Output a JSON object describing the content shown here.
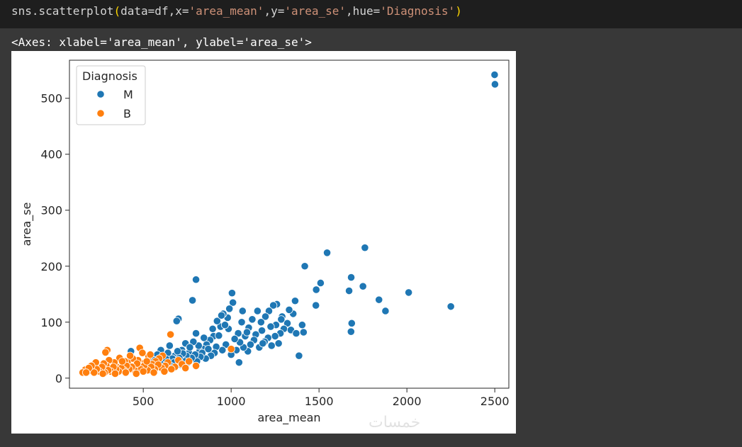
{
  "cell": {
    "code_prefix": "sns.scatterplot",
    "code_paren_open": "(",
    "code_arg1": "data=df,x=",
    "code_str1": "'area_mean'",
    "code_arg2": ",y=",
    "code_str2": "'area_se'",
    "code_arg3": ",hue=",
    "code_str3": "'Diagnosis'",
    "code_paren_close": ")"
  },
  "output": {
    "repr": "<Axes: xlabel='area_mean', ylabel='area_se'>"
  },
  "watermark": "خمسات",
  "colors": {
    "M": "#1f77b4",
    "B": "#ff7f0e"
  },
  "chart_data": {
    "type": "scatter",
    "xlabel": "area_mean",
    "ylabel": "area_se",
    "xlim": [
      80,
      2580
    ],
    "ylim": [
      -18,
      568
    ],
    "xticks": [
      500,
      1000,
      1500,
      2000,
      2500
    ],
    "yticks": [
      0,
      100,
      200,
      300,
      400,
      500
    ],
    "grid": false,
    "legend": {
      "title": "Diagnosis",
      "placement": "top-left",
      "entries": [
        "M",
        "B"
      ]
    },
    "series": [
      {
        "name": "M",
        "color": "#1f77b4",
        "points": [
          [
            2499,
            542
          ],
          [
            2501,
            525
          ],
          [
            1761,
            233
          ],
          [
            1546,
            224
          ],
          [
            1419,
            200
          ],
          [
            1683,
            180
          ],
          [
            1750,
            164
          ],
          [
            1509,
            170
          ],
          [
            1484,
            158
          ],
          [
            1671,
            156
          ],
          [
            2010,
            153
          ],
          [
            1841,
            140
          ],
          [
            1878,
            120
          ],
          [
            2250,
            128
          ],
          [
            1482,
            130
          ],
          [
            1686,
            98
          ],
          [
            1682,
            83
          ],
          [
            1386,
            40
          ],
          [
            1404,
            95
          ],
          [
            1412,
            82
          ],
          [
            1364,
            138
          ],
          [
            1353,
            115
          ],
          [
            1320,
            98
          ],
          [
            1290,
            110
          ],
          [
            1260,
            132
          ],
          [
            1240,
            130
          ],
          [
            1215,
            120
          ],
          [
            1195,
            110
          ],
          [
            1170,
            100
          ],
          [
            1150,
            120
          ],
          [
            1120,
            105
          ],
          [
            1100,
            90
          ],
          [
            1080,
            75
          ],
          [
            1060,
            100
          ],
          [
            1040,
            80
          ],
          [
            1010,
            135
          ],
          [
            1005,
            152
          ],
          [
            990,
            124
          ],
          [
            980,
            108
          ],
          [
            955,
            115
          ],
          [
            940,
            92
          ],
          [
            920,
            102
          ],
          [
            900,
            75
          ],
          [
            880,
            68
          ],
          [
            860,
            60
          ],
          [
            840,
            52
          ],
          [
            820,
            48
          ],
          [
            800,
            176
          ],
          [
            800,
            80
          ],
          [
            780,
            139
          ],
          [
            760,
            45
          ],
          [
            740,
            62
          ],
          [
            720,
            50
          ],
          [
            700,
            106
          ],
          [
            690,
            102
          ],
          [
            680,
            40
          ],
          [
            665,
            35
          ],
          [
            650,
            58
          ],
          [
            640,
            45
          ],
          [
            620,
            30
          ],
          [
            1300,
            88
          ],
          [
            1280,
            80
          ],
          [
            1270,
            62
          ],
          [
            1250,
            75
          ],
          [
            1230,
            58
          ],
          [
            1210,
            72
          ],
          [
            1190,
            65
          ],
          [
            1175,
            85
          ],
          [
            1160,
            55
          ],
          [
            1140,
            78
          ],
          [
            1130,
            68
          ],
          [
            1110,
            60
          ],
          [
            1095,
            48
          ],
          [
            1090,
            82
          ],
          [
            1070,
            55
          ],
          [
            1050,
            64
          ],
          [
            1030,
            50
          ],
          [
            1020,
            70
          ],
          [
            1000,
            42
          ],
          [
            985,
            88
          ],
          [
            970,
            60
          ],
          [
            965,
            95
          ],
          [
            950,
            50
          ],
          [
            930,
            76
          ],
          [
            915,
            56
          ],
          [
            905,
            45
          ],
          [
            895,
            88
          ],
          [
            885,
            40
          ],
          [
            870,
            52
          ],
          [
            855,
            35
          ],
          [
            845,
            72
          ],
          [
            835,
            45
          ],
          [
            825,
            38
          ],
          [
            815,
            58
          ],
          [
            805,
            30
          ],
          [
            795,
            42
          ],
          [
            785,
            65
          ],
          [
            775,
            36
          ],
          [
            765,
            55
          ],
          [
            755,
            28
          ],
          [
            745,
            40
          ],
          [
            735,
            30
          ],
          [
            725,
            44
          ],
          [
            715,
            24
          ],
          [
            705,
            36
          ],
          [
            695,
            48
          ],
          [
            675,
            28
          ],
          [
            655,
            22
          ],
          [
            630,
            34
          ],
          [
            600,
            50
          ],
          [
            580,
            42
          ],
          [
            560,
            32
          ],
          [
            430,
            48
          ],
          [
            1340,
            86
          ],
          [
            1370,
            80
          ],
          [
            1330,
            122
          ],
          [
            1285,
            105
          ],
          [
            1255,
            95
          ],
          [
            1225,
            92
          ],
          [
            1045,
            28
          ],
          [
            1180,
            62
          ],
          [
            1065,
            120
          ],
          [
            945,
            112
          ]
        ]
      },
      {
        "name": "B",
        "color": "#ff7f0e",
        "points": [
          [
            655,
            78
          ],
          [
            480,
            54
          ],
          [
            295,
            50
          ],
          [
            285,
            46
          ],
          [
            1000,
            52
          ],
          [
            610,
            40
          ],
          [
            590,
            35
          ],
          [
            570,
            30
          ],
          [
            550,
            25
          ],
          [
            530,
            38
          ],
          [
            510,
            28
          ],
          [
            495,
            45
          ],
          [
            470,
            32
          ],
          [
            455,
            22
          ],
          [
            440,
            35
          ],
          [
            425,
            40
          ],
          [
            410,
            28
          ],
          [
            395,
            30
          ],
          [
            380,
            24
          ],
          [
            365,
            36
          ],
          [
            350,
            20
          ],
          [
            335,
            28
          ],
          [
            320,
            18
          ],
          [
            305,
            32
          ],
          [
            290,
            22
          ],
          [
            275,
            26
          ],
          [
            260,
            16
          ],
          [
            245,
            20
          ],
          [
            230,
            28
          ],
          [
            215,
            14
          ],
          [
            200,
            18
          ],
          [
            185,
            12
          ],
          [
            170,
            15
          ],
          [
            155,
            10
          ],
          [
            640,
            28
          ],
          [
            625,
            22
          ],
          [
            605,
            18
          ],
          [
            585,
            24
          ],
          [
            565,
            16
          ],
          [
            545,
            20
          ],
          [
            525,
            14
          ],
          [
            505,
            22
          ],
          [
            485,
            16
          ],
          [
            465,
            26
          ],
          [
            450,
            14
          ],
          [
            435,
            20
          ],
          [
            420,
            16
          ],
          [
            405,
            22
          ],
          [
            390,
            14
          ],
          [
            375,
            18
          ],
          [
            360,
            12
          ],
          [
            345,
            16
          ],
          [
            330,
            20
          ],
          [
            315,
            12
          ],
          [
            300,
            14
          ],
          [
            280,
            10
          ],
          [
            265,
            20
          ],
          [
            250,
            12
          ],
          [
            235,
            16
          ],
          [
            220,
            10
          ],
          [
            205,
            22
          ],
          [
            190,
            18
          ],
          [
            175,
            10
          ],
          [
            700,
            32
          ],
          [
            720,
            25
          ],
          [
            760,
            30
          ],
          [
            800,
            22
          ],
          [
            740,
            18
          ],
          [
            680,
            20
          ],
          [
            660,
            16
          ],
          [
            460,
            8
          ],
          [
            400,
            10
          ],
          [
            340,
            8
          ],
          [
            270,
            8
          ],
          [
            560,
            10
          ],
          [
            620,
            12
          ],
          [
            500,
            12
          ],
          [
            520,
            30
          ],
          [
            540,
            42
          ],
          [
            380,
            30
          ]
        ]
      }
    ]
  }
}
